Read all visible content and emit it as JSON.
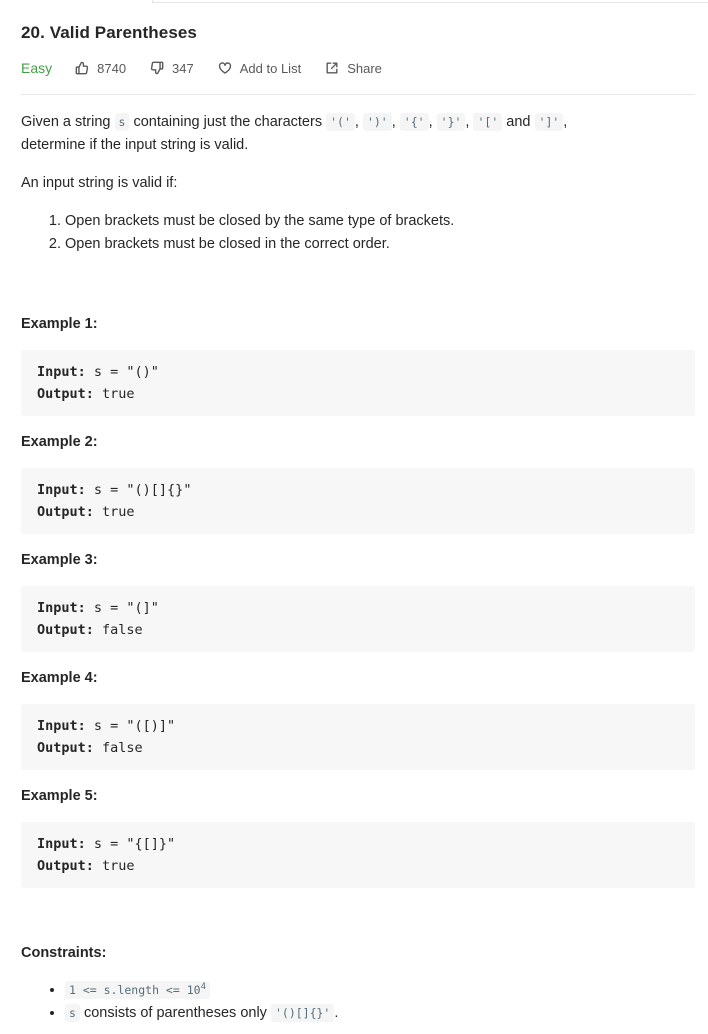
{
  "problem": {
    "title": "20. Valid Parentheses",
    "difficulty": "Easy",
    "likes": "8740",
    "dislikes": "347",
    "add_to_list_label": "Add to List",
    "share_label": "Share",
    "difficulty_color": "#43a047"
  },
  "description": {
    "intro_pre": "Given a string ",
    "intro_var": "s",
    "intro_mid": " containing just the characters ",
    "chars": [
      "'('",
      "')'",
      "'{'",
      "'}'",
      "'['",
      "']'"
    ],
    "sep_comma": ", ",
    "sep_and": " and ",
    "intro_end": ",",
    "intro_line2": "determine if the input string is valid.",
    "valid_if": "An input string is valid if:",
    "rules": [
      "Open brackets must be closed by the same type of brackets.",
      "Open brackets must be closed in the correct order."
    ]
  },
  "examples": [
    {
      "title": "Example 1:",
      "input_label": "Input:",
      "input": " s = \"()\"",
      "output_label": "Output:",
      "output": " true"
    },
    {
      "title": "Example 2:",
      "input_label": "Input:",
      "input": " s = \"()[]{}\"",
      "output_label": "Output:",
      "output": " true"
    },
    {
      "title": "Example 3:",
      "input_label": "Input:",
      "input": " s = \"(]\"",
      "output_label": "Output:",
      "output": " false"
    },
    {
      "title": "Example 4:",
      "input_label": "Input:",
      "input": " s = \"([)]\"",
      "output_label": "Output:",
      "output": " false"
    },
    {
      "title": "Example 5:",
      "input_label": "Input:",
      "input": " s = \"{[]}\"",
      "output_label": "Output:",
      "output": " true"
    }
  ],
  "constraints": {
    "title": "Constraints:",
    "c1_code": "1 <= s.length <= 10",
    "c1_sup": "4",
    "c2_var": "s",
    "c2_text": " consists of parentheses only ",
    "c2_code": "'()[]{}'",
    "c2_end": "."
  },
  "icons": {
    "likes": "thumbs-up-icon",
    "dislikes": "thumbs-down-icon",
    "add_to_list": "heart-icon",
    "share": "share-icon"
  }
}
